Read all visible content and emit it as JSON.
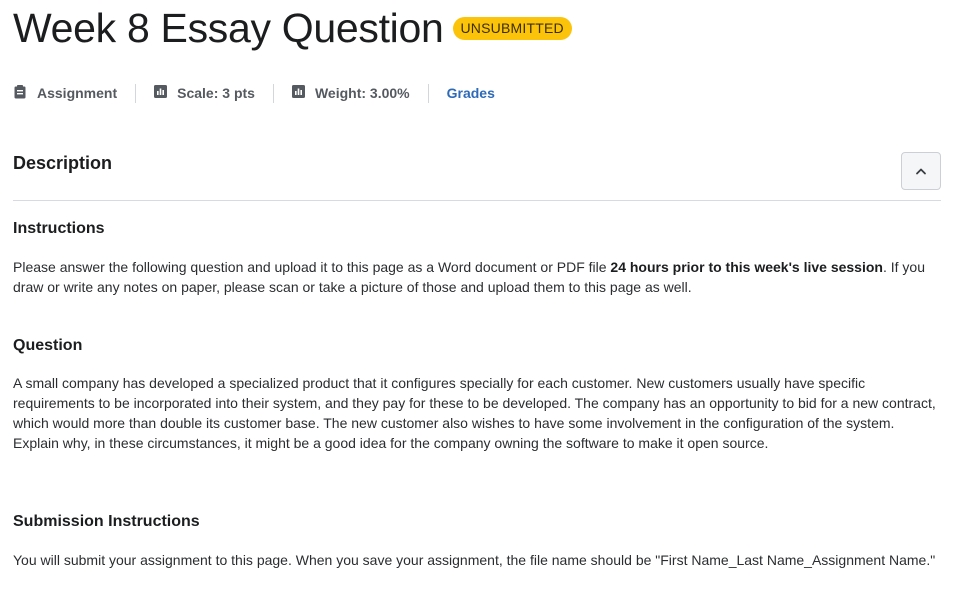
{
  "header": {
    "title": "Week 8 Essay Question",
    "status_badge": "UNSUBMITTED"
  },
  "meta": {
    "type_label": "Assignment",
    "type_icon": "clipboard-icon",
    "scale_label": "Scale: 3 pts",
    "scale_icon": "bar-chart-icon",
    "weight_label": "Weight: 3.00%",
    "weight_icon": "bar-chart-icon",
    "grades_link": "Grades"
  },
  "description": {
    "title": "Description",
    "collapse_icon": "chevron-up-icon",
    "sections": {
      "instructions": {
        "heading": "Instructions",
        "text_before": "Please answer the following question and upload it to this page as a Word document or PDF file ",
        "text_bold": "24 hours prior to this week's live session",
        "text_after": ". If you draw or write any notes on paper, please scan or take a picture of those and upload them to this page as well."
      },
      "question": {
        "heading": "Question",
        "text": "A small company has developed a specialized product that it configures specially for each customer. New customers usually have specific requirements to be incorporated into their system, and they pay for these to be developed. The company has an opportunity to bid for a new contract, which would more than double its customer base. The new customer also wishes to have some involvement in the configuration of the system. Explain why, in these circumstances, it might be a good idea for the company owning the software to make it open source."
      },
      "submission": {
        "heading": "Submission Instructions",
        "text": "You will submit your assignment to this page. When you save your assignment, the file name should be \"First Name_Last Name_Assignment Name.\""
      }
    }
  },
  "colors": {
    "badge": "#fcc30b",
    "link": "#2d6ab8",
    "divider": "#d7dae0"
  }
}
